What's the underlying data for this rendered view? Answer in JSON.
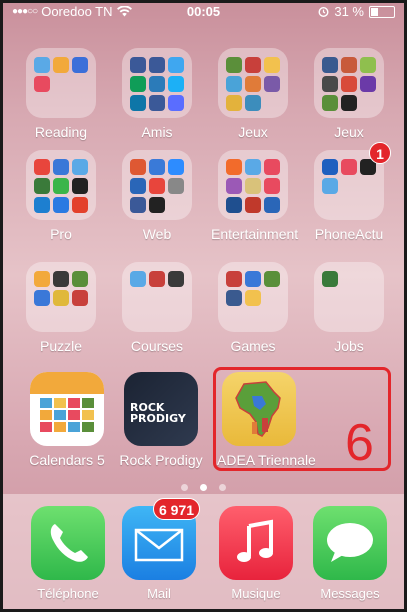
{
  "status_bar": {
    "carrier": "Ooredoo TN",
    "signal_dots": "●●●○○",
    "time": "00:05",
    "battery": "31 %",
    "battery_level": 0.31
  },
  "folders": [
    {
      "label": "Reading",
      "colors": [
        "#5aa9e6",
        "#f2a93b",
        "#3b6fd9",
        "#e84a5f"
      ]
    },
    {
      "label": "Amis",
      "colors": [
        "#3b5998",
        "#3b5998",
        "#3fa7f0",
        "#0f9d58",
        "#2b7bb9",
        "#1cb0f6",
        "#0e76a8",
        "#3b5998",
        "#5a6dff"
      ]
    },
    {
      "label": "Jeux",
      "colors": [
        "#5b8f3a",
        "#c8403b",
        "#f2c14e",
        "#4aa3d8",
        "#e07b39",
        "#7a5aa8",
        "#e3b23c",
        "#3c8dbc"
      ]
    },
    {
      "label": "Jeux",
      "colors": [
        "#3a5a8f",
        "#c85a3b",
        "#8fbf4e",
        "#4a4a4a",
        "#d84a3a",
        "#6b3aa8",
        "#5a8f3a",
        "#222"
      ]
    },
    {
      "label": "Pro",
      "colors": [
        "#e8453c",
        "#3a78d8",
        "#5aa9e6",
        "#3a7a3a",
        "#3ab54a",
        "#222",
        "#1d7fd0",
        "#2a7ae2",
        "#e3402b"
      ]
    },
    {
      "label": "Web",
      "colors": [
        "#de5833",
        "#3a7ad8",
        "#2d8cff",
        "#2a66b8",
        "#e8453c",
        "#888",
        "#3b5998",
        "#222"
      ]
    },
    {
      "label": "Entertainment",
      "colors": [
        "#f26b2b",
        "#5aa9e6",
        "#e84a5f",
        "#9b59b6",
        "#d9c27a",
        "#e84a5f",
        "#1f4f8f",
        "#c0392b",
        "#2a66b8"
      ]
    },
    {
      "label": "PhoneActu",
      "colors": [
        "#1f5fbf",
        "#e84a5f",
        "#222",
        "#5aa9e6"
      ],
      "badge": "1"
    },
    {
      "label": "Puzzle",
      "colors": [
        "#f2a93b",
        "#3a3a3a",
        "#5a8f3a",
        "#3a78d8",
        "#e0b83a",
        "#c8403b"
      ]
    },
    {
      "label": "Courses",
      "colors": [
        "#5aa9e6",
        "#c8403b",
        "#3a3a3a"
      ]
    },
    {
      "label": "Games",
      "colors": [
        "#c8403b",
        "#3a78d8",
        "#5a8f3a",
        "#3a5a8f",
        "#f2c14e"
      ]
    },
    {
      "label": "Jobs",
      "colors": [
        "#3a7a3a"
      ]
    }
  ],
  "apps_row": [
    {
      "label": "Calendars 5"
    },
    {
      "label": "Rock Prodigy",
      "logo_line1": "ROCK",
      "logo_line2": "PRODIGY"
    },
    {
      "label": "ADEA Triennale"
    }
  ],
  "annotation": {
    "number": "6"
  },
  "pages": {
    "count": 3,
    "active": 1
  },
  "dock": [
    {
      "label": "Téléphone"
    },
    {
      "label": "Mail",
      "badge": "6 971"
    },
    {
      "label": "Musique"
    },
    {
      "label": "Messages"
    }
  ]
}
